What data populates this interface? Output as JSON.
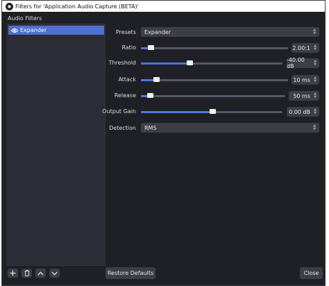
{
  "window": {
    "title": "Filters for 'Application Audio Capture (BETA)'"
  },
  "sidebar": {
    "label": "Audio Filters",
    "items": [
      {
        "name": "Expander",
        "icon": "eye-icon"
      }
    ]
  },
  "properties": {
    "presets": {
      "label": "Presets",
      "value": "Expander"
    },
    "ratio": {
      "label": "Ratio",
      "value": "2.00:1",
      "level": 0.06
    },
    "threshold": {
      "label": "Threshold",
      "value": "-40.00 dB",
      "level": 0.35
    },
    "attack": {
      "label": "Attack",
      "value": "10 ms",
      "level": 0.07
    },
    "release": {
      "label": "Release",
      "value": "50 ms",
      "level": 0.05
    },
    "output_gain": {
      "label": "Output Gain",
      "value": "0.00 dB",
      "level": 0.5
    },
    "detection": {
      "label": "Detection",
      "value": "RMS"
    }
  },
  "toolbar": {
    "add_icon": "plus-icon",
    "remove_icon": "trash-icon",
    "up_icon": "chevron-up-icon",
    "down_icon": "chevron-down-icon"
  },
  "buttons": {
    "restore_defaults": "Restore Defaults",
    "close": "Close"
  },
  "colors": {
    "accent": "#4e74de",
    "selection": "#4f6fd1",
    "background": "#1f2026"
  }
}
